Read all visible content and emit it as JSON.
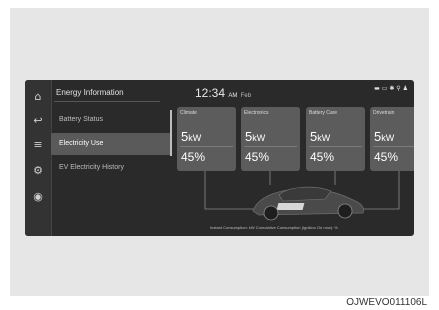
{
  "sidebar": {
    "icons": [
      "home-icon",
      "back-icon",
      "menu-icon",
      "settings-icon",
      "ev-icon"
    ]
  },
  "menu": {
    "title": "Energy Information",
    "items": [
      {
        "label": "Battery Status",
        "active": false
      },
      {
        "label": "Electricity Use",
        "active": true
      },
      {
        "label": "EV Electricity History",
        "active": false
      }
    ]
  },
  "header": {
    "time": "12:34",
    "ampm": "AM",
    "date": "Feb"
  },
  "cards": [
    {
      "callout": "1",
      "title": "Climate",
      "power": "5",
      "unit": "kW",
      "percent": "45%"
    },
    {
      "callout": "2",
      "title": "Electronics",
      "power": "5",
      "unit": "kW",
      "percent": "45%"
    },
    {
      "callout": "3",
      "title": "Battery Care",
      "power": "5",
      "unit": "kW",
      "percent": "45%"
    },
    {
      "callout": "4",
      "title": "Drivetrain",
      "power": "5",
      "unit": "kW",
      "percent": "45%"
    }
  ],
  "footer": {
    "caption": "Instant Consumption: kW    Cumulative Consumption (Ignition On now): %"
  },
  "image_code": "OJWEVO011106L"
}
